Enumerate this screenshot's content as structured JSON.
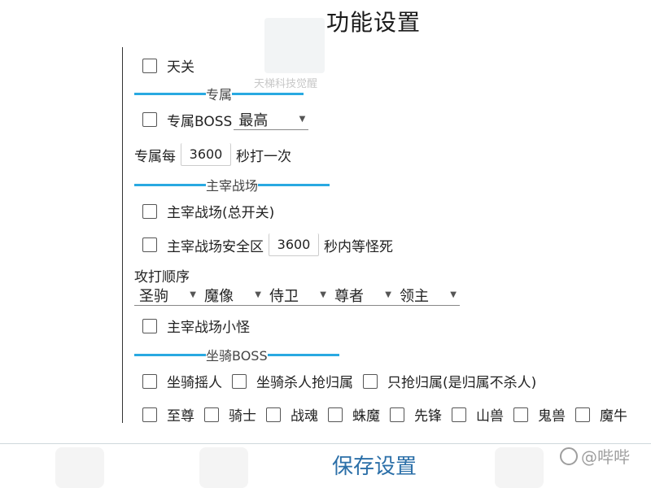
{
  "title": "功能设置",
  "watermark": "天梯科技觉醒",
  "toggle_master": {
    "label": "天关"
  },
  "section_exclusive": {
    "label": "专属"
  },
  "exclusive_boss": {
    "label": "专属BOSS",
    "select": "最高"
  },
  "exclusive_interval": {
    "prefix": "专属每",
    "value": "3600",
    "suffix": "秒打一次"
  },
  "section_dominator": {
    "label": "主宰战场"
  },
  "dominator_all": {
    "label": "主宰战场(总开关)"
  },
  "dominator_safe": {
    "label": "主宰战场安全区",
    "value": "3600",
    "suffix": "秒内等怪死"
  },
  "attack_order": {
    "label": "攻打顺序",
    "options": [
      "圣驹",
      "魔像",
      "侍卫",
      "尊者",
      "领主"
    ]
  },
  "dominator_minion": {
    "label": "主宰战场小怪"
  },
  "section_mount": {
    "label": "坐骑BOSS"
  },
  "mount_options": [
    "坐骑摇人",
    "坐骑杀人抢归属",
    "只抢归属(是归属不杀人)"
  ],
  "mount_types": [
    "至尊",
    "骑士",
    "战魂",
    "蛛魔",
    "先锋",
    "山兽",
    "鬼兽",
    "魔牛"
  ],
  "save_button": "保存设置",
  "bottom_watermark": "@哔哔",
  "colors": {
    "accent": "#29a9e1",
    "button_text": "#2b6fa8"
  }
}
